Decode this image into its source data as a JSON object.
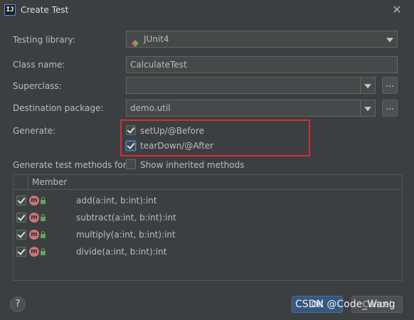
{
  "window": {
    "title": "Create Test",
    "app_icon_text": "IJ"
  },
  "form": {
    "testing_library": {
      "label": "Testing library:",
      "value": "JUnit4"
    },
    "class_name": {
      "label": "Class name:",
      "value": "CalculateTest"
    },
    "superclass": {
      "label": "Superclass:",
      "value": "",
      "browse_label": "..."
    },
    "destination_package": {
      "label": "Destination package:",
      "value": "demo.util",
      "browse_label": "..."
    },
    "generate": {
      "label": "Generate:",
      "options": [
        {
          "label": "setUp/@Before",
          "checked": true
        },
        {
          "label": "tearDown/@After",
          "checked": true
        }
      ]
    },
    "generate_methods": {
      "label": "Generate test methods for:",
      "show_inherited_label": "Show inherited methods",
      "show_inherited_checked": false
    }
  },
  "table": {
    "column_header": "Member",
    "rows": [
      {
        "checked": true,
        "badge": "m",
        "name": "add(a:int, b:int):int"
      },
      {
        "checked": true,
        "badge": "m",
        "name": "subtract(a:int, b:int):int"
      },
      {
        "checked": true,
        "badge": "m",
        "name": "multiply(a:int, b:int):int"
      },
      {
        "checked": true,
        "badge": "m",
        "name": "divide(a:int, b:int):int"
      }
    ]
  },
  "footer": {
    "help_label": "?",
    "ok_label": "OK",
    "cancel_label": "Cancel"
  },
  "watermark": "CSDN @Code_Wang",
  "colors": {
    "background": "#3c3f41",
    "field": "#45494a",
    "ok_button": "#365880",
    "highlight_box": "#d32f2f",
    "method_badge": "#c8767a"
  }
}
